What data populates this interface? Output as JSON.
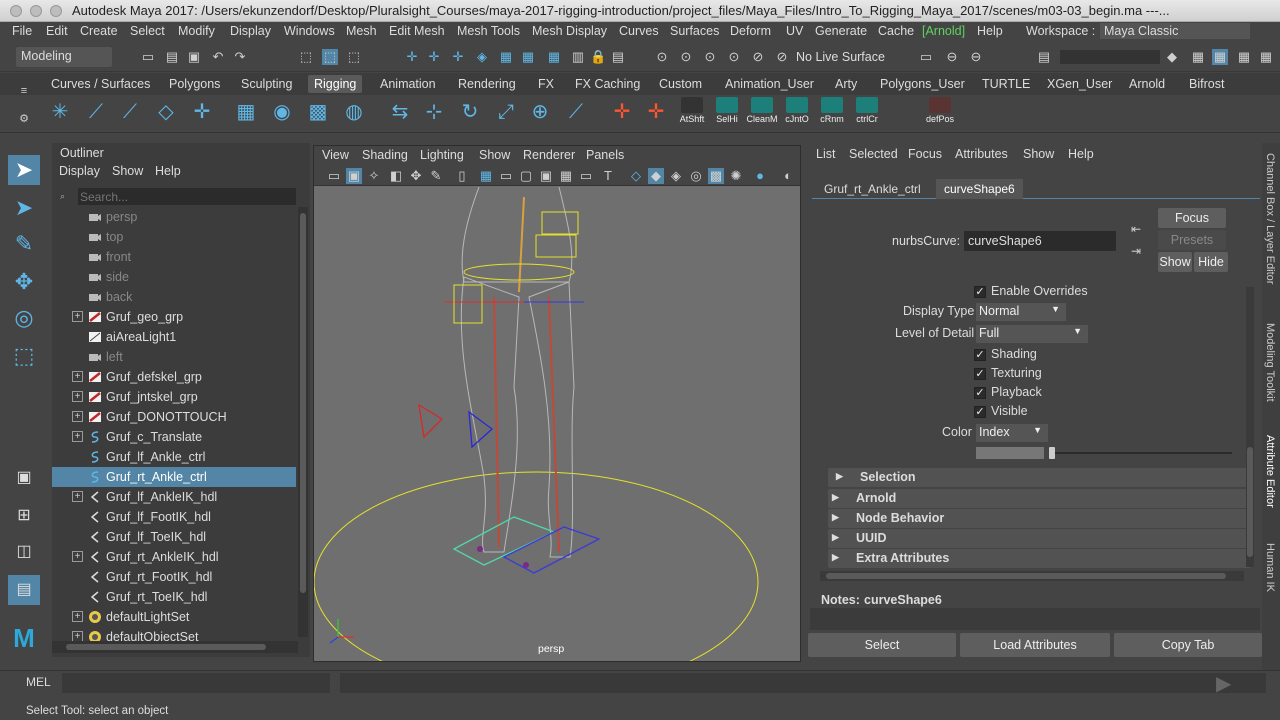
{
  "window": {
    "title": "Autodesk Maya 2017: /Users/ekunzendorf/Desktop/Pluralsight_Courses/maya-2017-rigging-introduction/project_files/Maya_Files/Intro_To_Rigging_Maya_2017/scenes/m03-03_begin.ma ---..."
  },
  "menubar": [
    "File",
    "Edit",
    "Create",
    "Select",
    "Modify",
    "Display",
    "Windows",
    "Mesh",
    "Edit Mesh",
    "Mesh Tools",
    "Mesh Display",
    "Curves",
    "Surfaces",
    "Deform",
    "UV",
    "Generate",
    "Cache",
    "[Arnold]",
    "Help"
  ],
  "workspace": {
    "label": "Workspace :",
    "value": "Maya Classic"
  },
  "statusline": {
    "mode": "Modeling",
    "live_surface": "No Live Surface"
  },
  "shelf_tabs": [
    "Curves / Surfaces",
    "Polygons",
    "Sculpting",
    "Rigging",
    "Animation",
    "Rendering",
    "FX",
    "FX Caching",
    "Custom",
    "Animation_User",
    "Arty",
    "Polygons_User",
    "TURTLE",
    "XGen_User",
    "Arnold",
    "Bifrost"
  ],
  "shelf_active": "Rigging",
  "shelf_scripts": [
    "AtShft",
    "SelHi",
    "CleanM",
    "cJntO",
    "cRnm",
    "ctrlCr",
    "defPos"
  ],
  "outliner": {
    "title": "Outliner",
    "menu": [
      "Display",
      "Show",
      "Help"
    ],
    "search_placeholder": "Search...",
    "items": [
      {
        "label": "persp",
        "dim": true,
        "type": "camera",
        "expand": false
      },
      {
        "label": "top",
        "dim": true,
        "type": "camera",
        "expand": false
      },
      {
        "label": "front",
        "dim": true,
        "type": "camera",
        "expand": false
      },
      {
        "label": "side",
        "dim": true,
        "type": "camera",
        "expand": false
      },
      {
        "label": "back",
        "dim": true,
        "type": "camera",
        "expand": false
      },
      {
        "label": "Gruf_geo_grp",
        "dim": false,
        "type": "group",
        "expand": true
      },
      {
        "label": "aiAreaLight1",
        "dim": false,
        "type": "light",
        "expand": false
      },
      {
        "label": "left",
        "dim": true,
        "type": "camera",
        "expand": false
      },
      {
        "label": "Gruf_defskel_grp",
        "dim": false,
        "type": "group",
        "expand": true
      },
      {
        "label": "Gruf_jntskel_grp",
        "dim": false,
        "type": "group",
        "expand": true
      },
      {
        "label": "Gruf_DONOTTOUCH",
        "dim": false,
        "type": "group",
        "expand": true
      },
      {
        "label": "Gruf_c_Translate",
        "dim": false,
        "type": "curve",
        "expand": true
      },
      {
        "label": "Gruf_lf_Ankle_ctrl",
        "dim": false,
        "type": "curve",
        "expand": false
      },
      {
        "label": "Gruf_rt_Ankle_ctrl",
        "dim": false,
        "type": "curve",
        "expand": false,
        "selected": true
      },
      {
        "label": "Gruf_lf_AnkleIK_hdl",
        "dim": false,
        "type": "ik",
        "expand": true
      },
      {
        "label": "Gruf_lf_FootIK_hdl",
        "dim": false,
        "type": "ik",
        "expand": false
      },
      {
        "label": "Gruf_lf_ToeIK_hdl",
        "dim": false,
        "type": "ik",
        "expand": false
      },
      {
        "label": "Gruf_rt_AnkleIK_hdl",
        "dim": false,
        "type": "ik",
        "expand": true
      },
      {
        "label": "Gruf_rt_FootIK_hdl",
        "dim": false,
        "type": "ik",
        "expand": false
      },
      {
        "label": "Gruf_rt_ToeIK_hdl",
        "dim": false,
        "type": "ik",
        "expand": false
      },
      {
        "label": "defaultLightSet",
        "dim": false,
        "type": "set",
        "expand": true
      },
      {
        "label": "defaultObjectSet",
        "dim": false,
        "type": "set",
        "expand": true
      }
    ]
  },
  "viewport": {
    "menu": [
      "View",
      "Shading",
      "Lighting",
      "Show",
      "Renderer",
      "Panels"
    ],
    "camera_label": "persp"
  },
  "attribute_editor": {
    "menu": [
      "List",
      "Selected",
      "Focus",
      "Attributes",
      "Show",
      "Help"
    ],
    "tabs": [
      "Gruf_rt_Ankle_ctrl",
      "curveShape6"
    ],
    "active_tab": "curveShape6",
    "node_type_label": "nurbsCurve:",
    "node_name": "curveShape6",
    "focus_btn": "Focus",
    "presets_btn": "Presets",
    "show_btn": "Show",
    "hide_btn": "Hide",
    "enable_overrides": "Enable Overrides",
    "display_type_label": "Display Type",
    "display_type_value": "Normal",
    "lod_label": "Level of Detail",
    "lod_value": "Full",
    "shading": "Shading",
    "texturing": "Texturing",
    "playback": "Playback",
    "visible": "Visible",
    "color_label": "Color",
    "color_value": "Index",
    "color_index_fraction": 0.0,
    "sections": [
      "Selection",
      "Arnold",
      "Node Behavior",
      "UUID",
      "Extra Attributes"
    ],
    "notes_label": "Notes:",
    "notes_value": "curveShape6",
    "bottom_buttons": [
      "Select",
      "Load Attributes",
      "Copy Tab"
    ]
  },
  "right_tabs": [
    "Channel Box / Layer Editor",
    "Modeling Toolkit",
    "Attribute Editor",
    "Human IK"
  ],
  "command_line": {
    "lang": "MEL"
  },
  "help_line": "Select Tool: select an object",
  "colors": {
    "selection": "#5285a6",
    "accent": "#5fb7e8",
    "curve_yellow": "#e6e12a"
  }
}
